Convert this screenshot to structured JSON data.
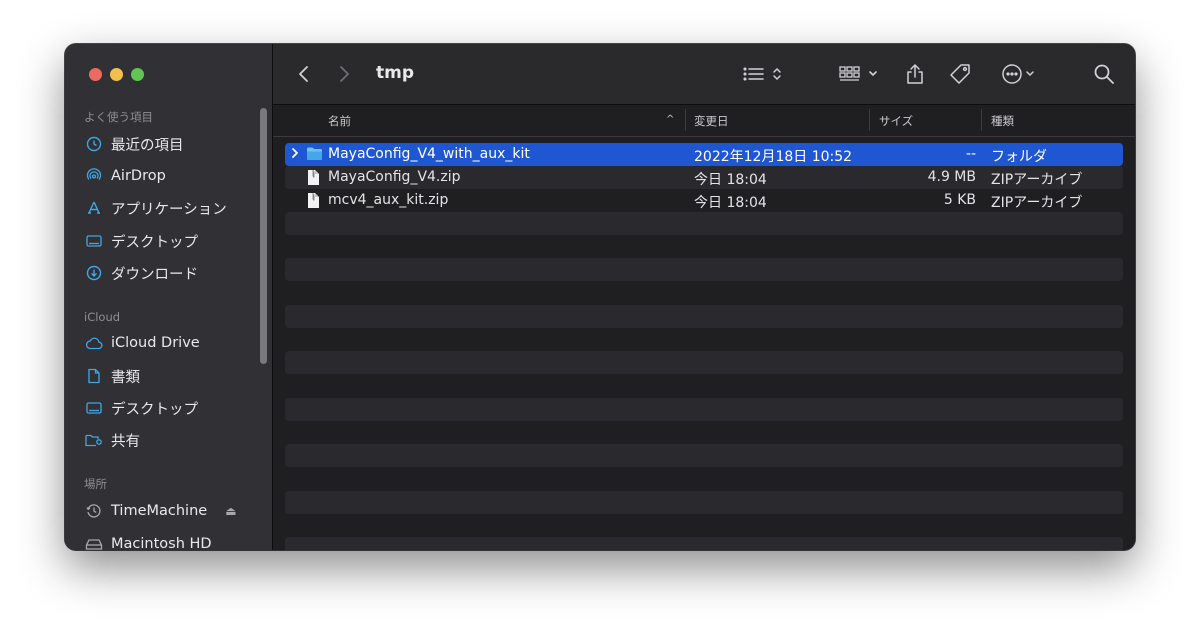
{
  "window": {
    "title": "tmp"
  },
  "sidebar": {
    "sections": [
      {
        "header": "よく使う項目",
        "items": [
          {
            "label": "最近の項目",
            "icon": "clock-icon"
          },
          {
            "label": "AirDrop",
            "icon": "airdrop-icon"
          },
          {
            "label": "アプリケーション",
            "icon": "applications-icon"
          },
          {
            "label": "デスクトップ",
            "icon": "desktop-icon"
          },
          {
            "label": "ダウンロード",
            "icon": "download-icon"
          }
        ]
      },
      {
        "header": "iCloud",
        "items": [
          {
            "label": "iCloud Drive",
            "icon": "cloud-icon"
          },
          {
            "label": "書類",
            "icon": "document-icon"
          },
          {
            "label": "デスクトップ",
            "icon": "desktop-icon"
          },
          {
            "label": "共有",
            "icon": "shared-folder-icon"
          }
        ]
      },
      {
        "header": "場所",
        "items": [
          {
            "label": "TimeMachine",
            "icon": "time-machine-icon"
          },
          {
            "label": "Macintosh HD",
            "icon": "disk-icon"
          }
        ]
      }
    ]
  },
  "columns": {
    "name": "名前",
    "date": "変更日",
    "size": "サイズ",
    "kind": "種類"
  },
  "files": [
    {
      "name": "MayaConfig_V4_with_aux_kit",
      "date": "2022年12月18日 10:52",
      "size": "--",
      "kind": "フォルダ",
      "type": "folder",
      "selected": true
    },
    {
      "name": "MayaConfig_V4.zip",
      "date": "今日 18:04",
      "size": "4.9 MB",
      "kind": "ZIPアーカイブ",
      "type": "zip",
      "selected": false
    },
    {
      "name": "mcv4_aux_kit.zip",
      "date": "今日 18:04",
      "size": "5 KB",
      "kind": "ZIPアーカイブ",
      "type": "zip",
      "selected": false
    }
  ],
  "colors": {
    "selection": "#1f57d2",
    "accent_icon": "#3ea7e8"
  }
}
